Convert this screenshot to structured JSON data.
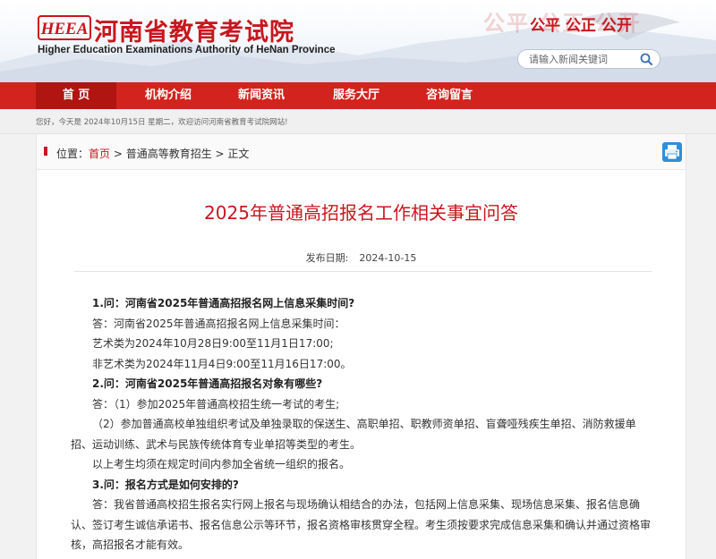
{
  "header": {
    "logo_mark": "HEEA",
    "title_cn": "河南省教育考试院",
    "title_en": "Higher Education Examinations Authority of HeNan Province",
    "slogan_bg": "公平 公正 公开",
    "slogan": "公平 公正 公开",
    "search": {
      "placeholder": "请输入新闻关键词",
      "value": ""
    },
    "colors": {
      "brand_red": "#c8161d",
      "nav_red": "#d2231f"
    }
  },
  "nav": {
    "items": [
      {
        "label": "首  页",
        "active": true
      },
      {
        "label": "机构介绍",
        "active": false
      },
      {
        "label": "新闻资讯",
        "active": false
      },
      {
        "label": "服务大厅",
        "active": false
      },
      {
        "label": "咨询留言",
        "active": false
      }
    ]
  },
  "welcome": {
    "text": "您好，今天是 2024年10月15日 星期二，欢迎访问河南省教育考试院网站!"
  },
  "breadcrumb": {
    "prefix": "位置：",
    "home": "首页",
    "sep": " > ",
    "section": "普通高等教育招生",
    "current": "正文"
  },
  "article": {
    "title": "2025年普通高招报名工作相关事宜问答",
    "date_label": "发布日期:",
    "date": "2024-10-15",
    "paragraphs": [
      {
        "text": "1.问：河南省2025年普通高招报名网上信息采集时间?",
        "bold": true
      },
      {
        "text": "答：河南省2025年普通高招报名网上信息采集时间：",
        "bold": false
      },
      {
        "text": "艺术类为2024年10月28日9:00至11月1日17:00;",
        "bold": false
      },
      {
        "text": "非艺术类为2024年11月4日9:00至11月16日17:00。",
        "bold": false
      },
      {
        "text": "2.问：河南省2025年普通高招报名对象有哪些?",
        "bold": true
      },
      {
        "text": "答：（1）参加2025年普通高校招生统一考试的考生;",
        "bold": false
      },
      {
        "text": "（2）参加普通高校单独组织考试及单独录取的保送生、高职单招、职教师资单招、盲聋哑残疾生单招、消防救援单招、运动训练、武术与民族传统体育专业单招等类型的考生。",
        "bold": false
      },
      {
        "text": "以上考生均须在规定时间内参加全省统一组织的报名。",
        "bold": false
      },
      {
        "text": "3.问：报名方式是如何安排的?",
        "bold": true
      },
      {
        "text": "答：我省普通高校招生报名实行网上报名与现场确认相结合的办法，包括网上信息采集、现场信息采集、报名信息确认、签订考生诚信承诺书、报名信息公示等环节，报名资格审核贯穿全程。考生须按要求完成信息采集和确认并通过资格审核，高招报名才能有效。",
        "bold": false
      }
    ]
  }
}
